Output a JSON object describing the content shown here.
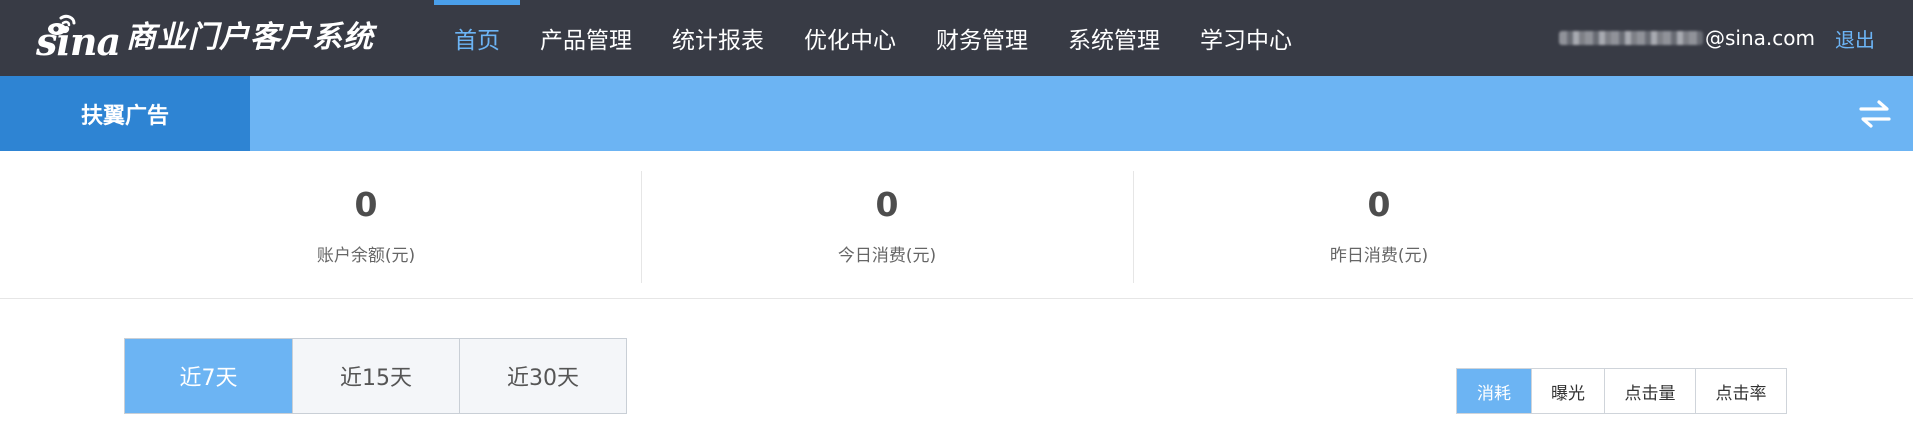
{
  "brand": {
    "logo_text": "sina",
    "title": "商业门户客户系统",
    "colors": {
      "topbar": "#383b45",
      "accent": "#6cb4f3",
      "accent_dark": "#2e84d3"
    }
  },
  "nav": {
    "items": [
      {
        "label": "首页",
        "active": true
      },
      {
        "label": "产品管理"
      },
      {
        "label": "统计报表"
      },
      {
        "label": "优化中心"
      },
      {
        "label": "财务管理"
      },
      {
        "label": "系统管理"
      },
      {
        "label": "学习中心"
      }
    ]
  },
  "user": {
    "email_suffix": "@sina.com",
    "logout_label": "退出"
  },
  "subbar": {
    "tab_label": "扶翼广告",
    "switch_icon": "swap-arrows-icon"
  },
  "stats": [
    {
      "value": "0",
      "label": "账户余额(元)"
    },
    {
      "value": "0",
      "label": "今日消费(元)"
    },
    {
      "value": "0",
      "label": "昨日消费(元)"
    }
  ],
  "period_tabs": [
    {
      "label": "近7天",
      "active": true
    },
    {
      "label": "近15天"
    },
    {
      "label": "近30天"
    }
  ],
  "metric_tabs": [
    {
      "label": "消耗",
      "active": true
    },
    {
      "label": "曝光"
    },
    {
      "label": "点击量"
    },
    {
      "label": "点击率"
    }
  ]
}
